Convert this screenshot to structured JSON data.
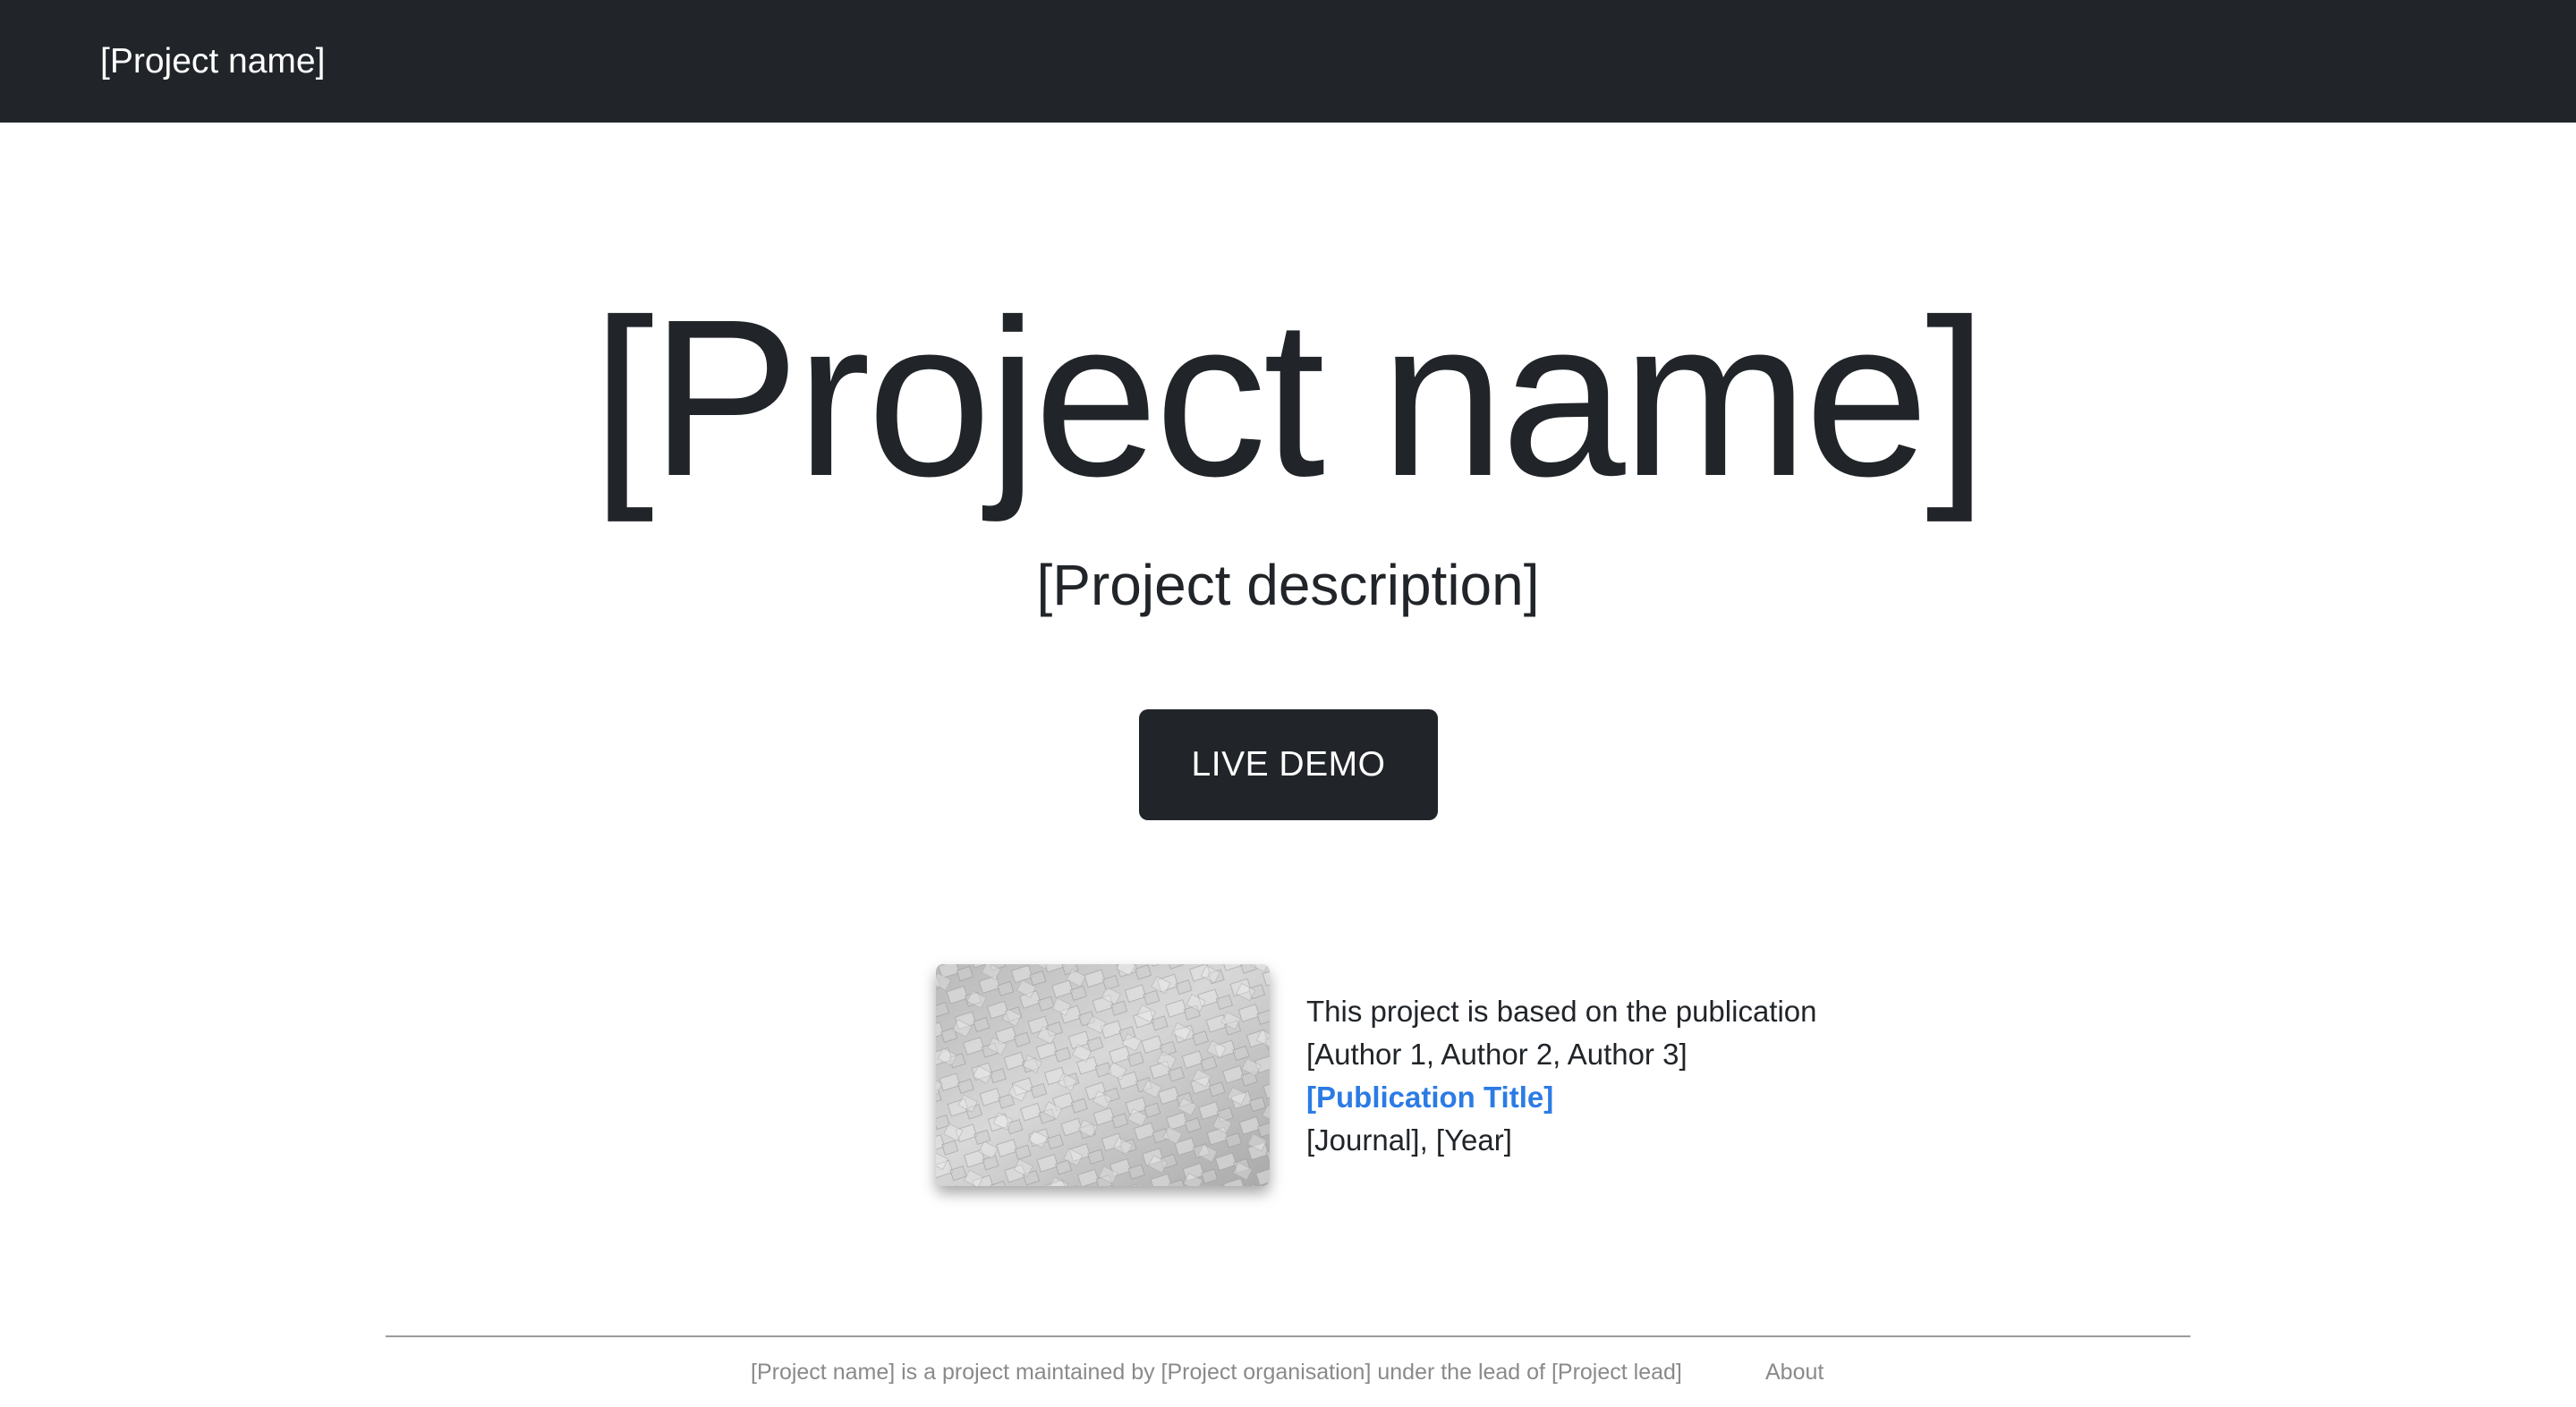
{
  "navbar": {
    "brand": "[Project name]"
  },
  "hero": {
    "title": "[Project name]",
    "description": "[Project description]",
    "button_label": "LIVE DEMO"
  },
  "publication": {
    "intro": "This project is based on the publication",
    "authors": "[Author 1, Author 2, Author 3]",
    "title": "[Publication Title]",
    "journal_year": "[Journal], [Year]",
    "thumbnail_icon": "publication-thumbnail-image"
  },
  "footer": {
    "text": "[Project name] is a project maintained by [Project organisation] under the lead of [Project lead]",
    "about_label": "About"
  },
  "colors": {
    "navbar_bg": "#212529",
    "button_bg": "#212529",
    "link": "#2c7be5",
    "footer_text": "#8a8a8a"
  }
}
